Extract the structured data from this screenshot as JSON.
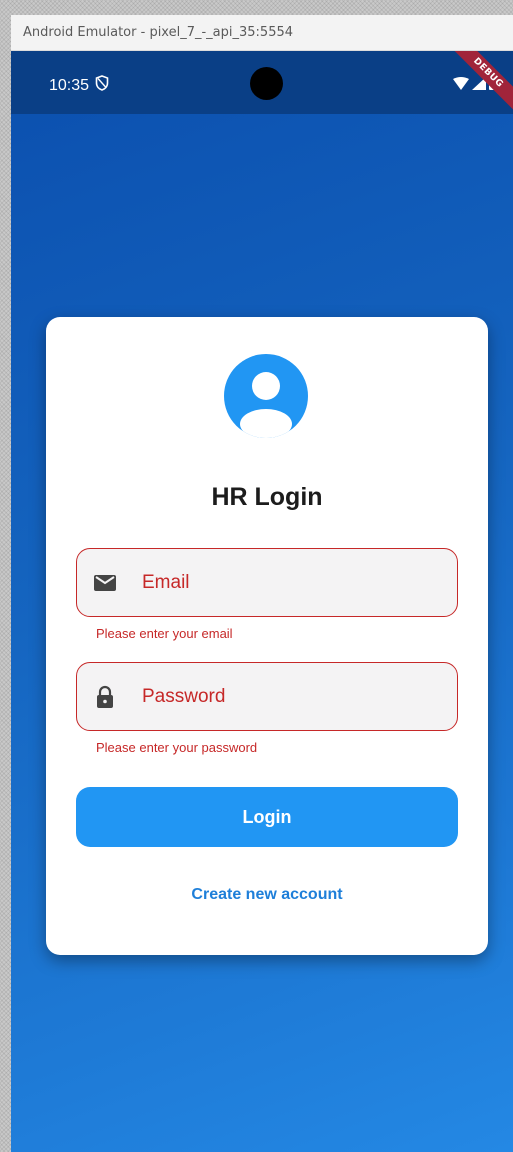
{
  "window": {
    "title": "Android Emulator - pixel_7_-_api_35:5554"
  },
  "status_bar": {
    "time": "10:35",
    "debug_label": "DEBUG"
  },
  "login": {
    "title": "HR Login",
    "email": {
      "placeholder": "Email",
      "error": "Please enter your email"
    },
    "password": {
      "placeholder": "Password",
      "error": "Please enter your password"
    },
    "login_label": "Login",
    "create_account_label": "Create new account"
  },
  "colors": {
    "primary": "#2196f3",
    "error": "#c62828",
    "status_bar": "#0a3f86"
  },
  "icons": [
    "shield-icon",
    "wifi-icon",
    "signal-icon",
    "battery-icon",
    "account-circle-icon",
    "email-icon",
    "lock-icon"
  ]
}
